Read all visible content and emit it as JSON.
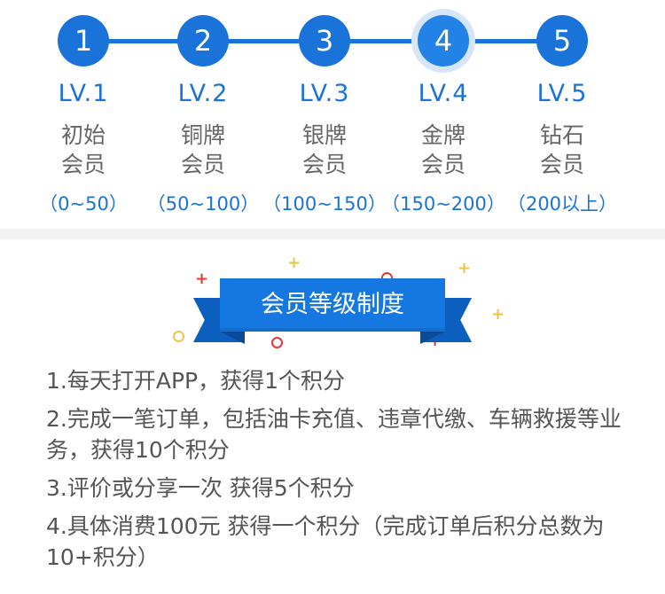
{
  "levels": [
    {
      "num": "1",
      "name": "LV.1",
      "title_line1": "初始",
      "title_line2": "会员",
      "range": "（0~50）",
      "active": false
    },
    {
      "num": "2",
      "name": "LV.2",
      "title_line1": "铜牌",
      "title_line2": "会员",
      "range": "（50~100）",
      "active": false
    },
    {
      "num": "3",
      "name": "LV.3",
      "title_line1": "银牌",
      "title_line2": "会员",
      "range": "（100~150）",
      "active": false
    },
    {
      "num": "4",
      "name": "LV.4",
      "title_line1": "金牌",
      "title_line2": "会员",
      "range": "（150~200）",
      "active": true
    },
    {
      "num": "5",
      "name": "LV.5",
      "title_line1": "钻石",
      "title_line2": "会员",
      "range": "（200以上）",
      "active": false
    }
  ],
  "banner": {
    "title": "会员等级制度"
  },
  "rules": [
    "1.每天打开APP，获得1个积分",
    "2.完成一笔订单，包括油卡充值、违章代缴、车辆救援等业务，获得10个积分",
    "3.评价或分享一次 获得5个积分",
    "4.具体消费100元 获得一个积分（完成订单后积分总数为10+积分）"
  ],
  "colors": {
    "accent": "#1a73d8",
    "active_halo": "#d6e6f8",
    "ribbon": "#1578e0",
    "text": "#555555"
  }
}
